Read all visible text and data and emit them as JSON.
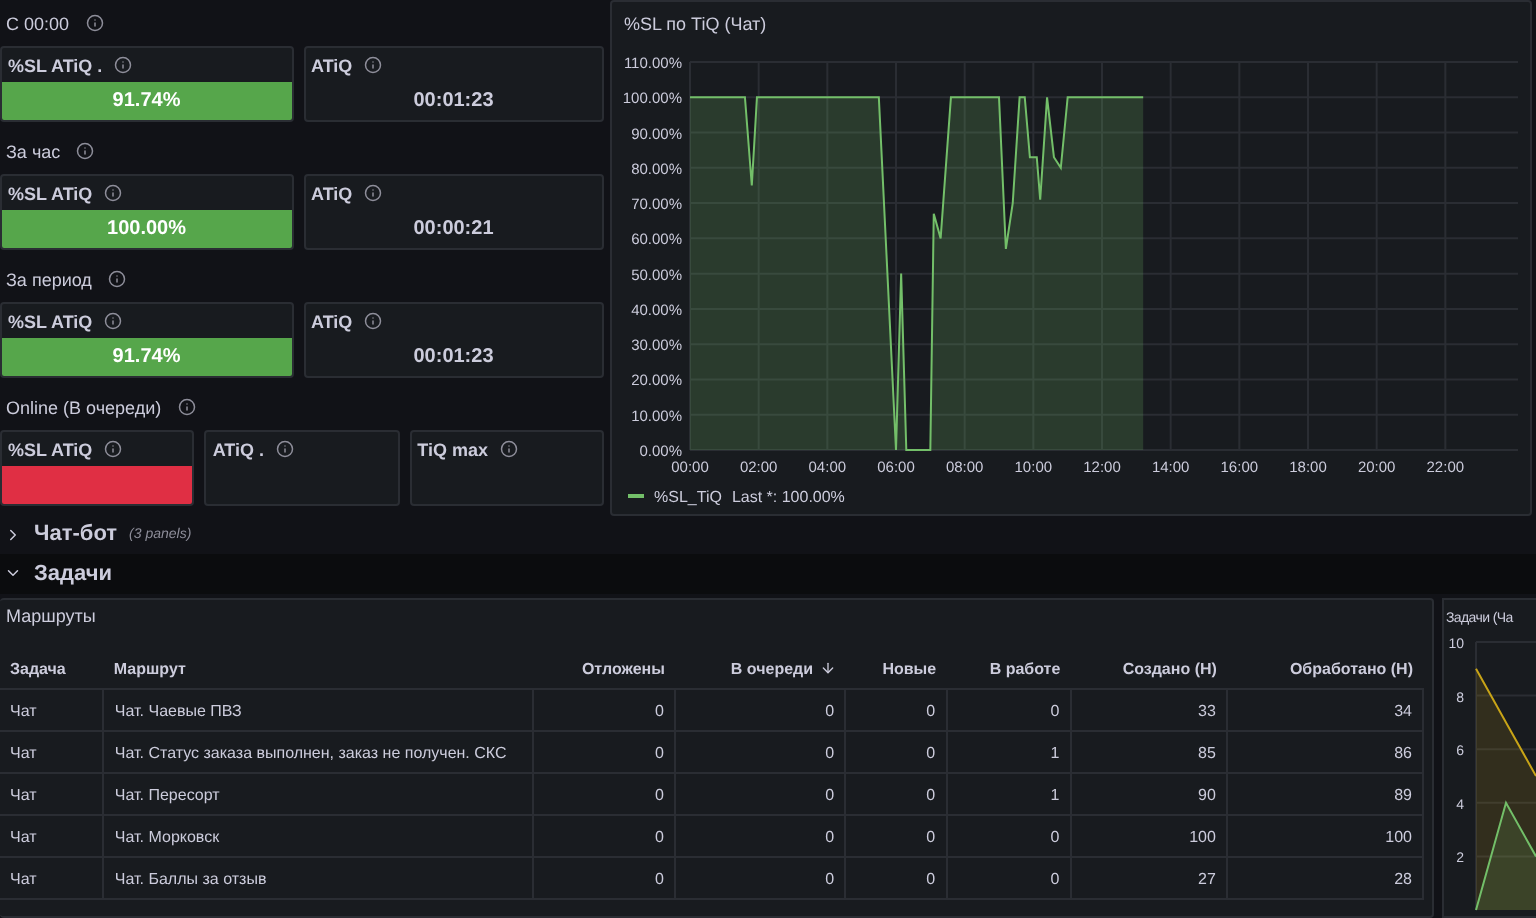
{
  "stat_groups": [
    {
      "heading": "С 00:00",
      "panels": [
        {
          "title": "%SL ATiQ .",
          "value": "91.74%",
          "color": "#56a64b"
        },
        {
          "title": "ATiQ",
          "value": "00:01:23"
        }
      ]
    },
    {
      "heading": "За час",
      "panels": [
        {
          "title": "%SL ATiQ",
          "value": "100.00%",
          "color": "#56a64b"
        },
        {
          "title": "ATiQ",
          "value": "00:00:21"
        }
      ]
    },
    {
      "heading": "За период",
      "panels": [
        {
          "title": "%SL ATiQ",
          "value": "91.74%",
          "color": "#56a64b"
        },
        {
          "title": "ATiQ",
          "value": "00:01:23"
        }
      ]
    },
    {
      "heading": "Online (В очереди)",
      "panels": [
        {
          "title": "%SL ATiQ",
          "color": "#e02f44"
        },
        {
          "title": "ATiQ ."
        },
        {
          "title": "TiQ max"
        }
      ]
    }
  ],
  "sl_chart": {
    "title": "%SL по TiQ (Чат)",
    "legend_value": "Last *: 100.00%",
    "chart_data": {
      "type": "area",
      "grid": true,
      "x": [
        0,
        1.6,
        1.8,
        1.95,
        5.5,
        6.0,
        6.15,
        6.3,
        7.0,
        7.1,
        7.3,
        7.6,
        9.0,
        9.2,
        9.4,
        9.6,
        9.75,
        9.9,
        10.1,
        10.2,
        10.4,
        10.6,
        10.8,
        11.0,
        13.2
      ],
      "series": [
        {
          "name": "%SL_TiQ",
          "color": "#73bf69",
          "values": [
            100,
            100,
            75,
            100,
            100,
            0,
            50,
            0,
            0,
            67,
            60,
            100,
            100,
            57,
            70,
            100,
            100,
            83,
            83,
            71,
            100,
            83,
            80,
            100,
            100
          ]
        }
      ],
      "xlim": [
        0,
        24
      ],
      "ylim": [
        0,
        110
      ],
      "xticks": [
        {
          "value": 0,
          "label": "00:00"
        },
        {
          "value": 2,
          "label": "02:00"
        },
        {
          "value": 4,
          "label": "04:00"
        },
        {
          "value": 6,
          "label": "06:00"
        },
        {
          "value": 8,
          "label": "08:00"
        },
        {
          "value": 10,
          "label": "10:00"
        },
        {
          "value": 12,
          "label": "12:00"
        },
        {
          "value": 14,
          "label": "14:00"
        },
        {
          "value": 16,
          "label": "16:00"
        },
        {
          "value": 18,
          "label": "18:00"
        },
        {
          "value": 20,
          "label": "20:00"
        },
        {
          "value": 22,
          "label": "22:00"
        }
      ],
      "yticks": [
        {
          "value": 0,
          "label": "0.00%"
        },
        {
          "value": 10,
          "label": "10.00%"
        },
        {
          "value": 20,
          "label": "20.00%"
        },
        {
          "value": 30,
          "label": "30.00%"
        },
        {
          "value": 40,
          "label": "40.00%"
        },
        {
          "value": 50,
          "label": "50.00%"
        },
        {
          "value": 60,
          "label": "60.00%"
        },
        {
          "value": 70,
          "label": "70.00%"
        },
        {
          "value": 80,
          "label": "80.00%"
        },
        {
          "value": 90,
          "label": "90.00%"
        },
        {
          "value": 100,
          "label": "100.00%"
        },
        {
          "value": 110,
          "label": "110.00%"
        }
      ]
    }
  },
  "rows": [
    {
      "title": "Чат-бот",
      "note": "(3 panels)",
      "expanded": false
    },
    {
      "title": "Задачи",
      "expanded": true
    }
  ],
  "routes_table": {
    "title": "Маршруты",
    "columns": [
      {
        "label": "Задача",
        "sorted": false
      },
      {
        "label": "Маршрут",
        "sorted": false
      },
      {
        "label": "Отложены",
        "sorted": false
      },
      {
        "label": "В очереди",
        "sorted": true
      },
      {
        "label": "Новые",
        "sorted": false
      },
      {
        "label": "В работе",
        "sorted": false
      },
      {
        "label": "Создано (Н)",
        "sorted": false
      },
      {
        "label": "Обработано (Н)",
        "sorted": false
      }
    ],
    "rows": [
      [
        "Чат",
        "Чат. Чаевые ПВЗ",
        "0",
        "0",
        "0",
        "0",
        "33",
        "34"
      ],
      [
        "Чат",
        "Чат. Статус заказа выполнен, заказ не получен. СКС",
        "0",
        "0",
        "0",
        "1",
        "85",
        "86"
      ],
      [
        "Чат",
        "Чат. Пересорт",
        "0",
        "0",
        "0",
        "1",
        "90",
        "89"
      ],
      [
        "Чат",
        "Чат. Морковск",
        "0",
        "0",
        "0",
        "0",
        "100",
        "100"
      ],
      [
        "Чат",
        "Чат. Баллы за отзыв",
        "0",
        "0",
        "0",
        "0",
        "27",
        "28"
      ]
    ]
  },
  "tasks_chart": {
    "title": "Задачи (Ча",
    "chart_data": {
      "type": "area",
      "grid": true,
      "ylim": [
        0,
        10
      ],
      "yticks": [
        2,
        4,
        6,
        8,
        10
      ],
      "series": [
        {
          "color": "#c8a417",
          "values": [
            9,
            7,
            5
          ]
        },
        {
          "color": "#73bf69",
          "values": [
            0,
            4,
            2
          ]
        }
      ]
    }
  }
}
